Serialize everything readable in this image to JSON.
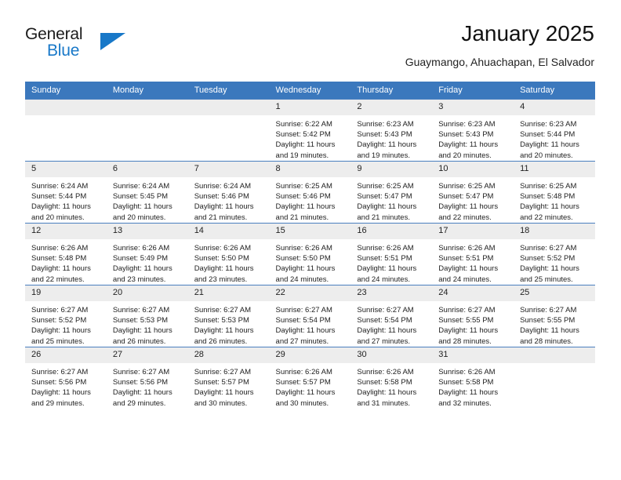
{
  "brand": {
    "word_top": "General",
    "word_bottom": "Blue",
    "triangle_icon": "triangle-icon",
    "accent_color": "#1878c8"
  },
  "header": {
    "title": "January 2025",
    "subtitle": "Guaymango, Ahuachapan, El Salvador"
  },
  "calendar": {
    "header_color": "#3b78bd",
    "daynum_band_color": "#ededed",
    "weekday_headers": [
      "Sunday",
      "Monday",
      "Tuesday",
      "Wednesday",
      "Thursday",
      "Friday",
      "Saturday"
    ],
    "weeks": [
      [
        {
          "day": "",
          "sunrise": "",
          "sunset": "",
          "daylight_line1": "",
          "daylight_line2": ""
        },
        {
          "day": "",
          "sunrise": "",
          "sunset": "",
          "daylight_line1": "",
          "daylight_line2": ""
        },
        {
          "day": "",
          "sunrise": "",
          "sunset": "",
          "daylight_line1": "",
          "daylight_line2": ""
        },
        {
          "day": "1",
          "sunrise": "Sunrise: 6:22 AM",
          "sunset": "Sunset: 5:42 PM",
          "daylight_line1": "Daylight: 11 hours",
          "daylight_line2": "and 19 minutes."
        },
        {
          "day": "2",
          "sunrise": "Sunrise: 6:23 AM",
          "sunset": "Sunset: 5:43 PM",
          "daylight_line1": "Daylight: 11 hours",
          "daylight_line2": "and 19 minutes."
        },
        {
          "day": "3",
          "sunrise": "Sunrise: 6:23 AM",
          "sunset": "Sunset: 5:43 PM",
          "daylight_line1": "Daylight: 11 hours",
          "daylight_line2": "and 20 minutes."
        },
        {
          "day": "4",
          "sunrise": "Sunrise: 6:23 AM",
          "sunset": "Sunset: 5:44 PM",
          "daylight_line1": "Daylight: 11 hours",
          "daylight_line2": "and 20 minutes."
        }
      ],
      [
        {
          "day": "5",
          "sunrise": "Sunrise: 6:24 AM",
          "sunset": "Sunset: 5:44 PM",
          "daylight_line1": "Daylight: 11 hours",
          "daylight_line2": "and 20 minutes."
        },
        {
          "day": "6",
          "sunrise": "Sunrise: 6:24 AM",
          "sunset": "Sunset: 5:45 PM",
          "daylight_line1": "Daylight: 11 hours",
          "daylight_line2": "and 20 minutes."
        },
        {
          "day": "7",
          "sunrise": "Sunrise: 6:24 AM",
          "sunset": "Sunset: 5:46 PM",
          "daylight_line1": "Daylight: 11 hours",
          "daylight_line2": "and 21 minutes."
        },
        {
          "day": "8",
          "sunrise": "Sunrise: 6:25 AM",
          "sunset": "Sunset: 5:46 PM",
          "daylight_line1": "Daylight: 11 hours",
          "daylight_line2": "and 21 minutes."
        },
        {
          "day": "9",
          "sunrise": "Sunrise: 6:25 AM",
          "sunset": "Sunset: 5:47 PM",
          "daylight_line1": "Daylight: 11 hours",
          "daylight_line2": "and 21 minutes."
        },
        {
          "day": "10",
          "sunrise": "Sunrise: 6:25 AM",
          "sunset": "Sunset: 5:47 PM",
          "daylight_line1": "Daylight: 11 hours",
          "daylight_line2": "and 22 minutes."
        },
        {
          "day": "11",
          "sunrise": "Sunrise: 6:25 AM",
          "sunset": "Sunset: 5:48 PM",
          "daylight_line1": "Daylight: 11 hours",
          "daylight_line2": "and 22 minutes."
        }
      ],
      [
        {
          "day": "12",
          "sunrise": "Sunrise: 6:26 AM",
          "sunset": "Sunset: 5:48 PM",
          "daylight_line1": "Daylight: 11 hours",
          "daylight_line2": "and 22 minutes."
        },
        {
          "day": "13",
          "sunrise": "Sunrise: 6:26 AM",
          "sunset": "Sunset: 5:49 PM",
          "daylight_line1": "Daylight: 11 hours",
          "daylight_line2": "and 23 minutes."
        },
        {
          "day": "14",
          "sunrise": "Sunrise: 6:26 AM",
          "sunset": "Sunset: 5:50 PM",
          "daylight_line1": "Daylight: 11 hours",
          "daylight_line2": "and 23 minutes."
        },
        {
          "day": "15",
          "sunrise": "Sunrise: 6:26 AM",
          "sunset": "Sunset: 5:50 PM",
          "daylight_line1": "Daylight: 11 hours",
          "daylight_line2": "and 24 minutes."
        },
        {
          "day": "16",
          "sunrise": "Sunrise: 6:26 AM",
          "sunset": "Sunset: 5:51 PM",
          "daylight_line1": "Daylight: 11 hours",
          "daylight_line2": "and 24 minutes."
        },
        {
          "day": "17",
          "sunrise": "Sunrise: 6:26 AM",
          "sunset": "Sunset: 5:51 PM",
          "daylight_line1": "Daylight: 11 hours",
          "daylight_line2": "and 24 minutes."
        },
        {
          "day": "18",
          "sunrise": "Sunrise: 6:27 AM",
          "sunset": "Sunset: 5:52 PM",
          "daylight_line1": "Daylight: 11 hours",
          "daylight_line2": "and 25 minutes."
        }
      ],
      [
        {
          "day": "19",
          "sunrise": "Sunrise: 6:27 AM",
          "sunset": "Sunset: 5:52 PM",
          "daylight_line1": "Daylight: 11 hours",
          "daylight_line2": "and 25 minutes."
        },
        {
          "day": "20",
          "sunrise": "Sunrise: 6:27 AM",
          "sunset": "Sunset: 5:53 PM",
          "daylight_line1": "Daylight: 11 hours",
          "daylight_line2": "and 26 minutes."
        },
        {
          "day": "21",
          "sunrise": "Sunrise: 6:27 AM",
          "sunset": "Sunset: 5:53 PM",
          "daylight_line1": "Daylight: 11 hours",
          "daylight_line2": "and 26 minutes."
        },
        {
          "day": "22",
          "sunrise": "Sunrise: 6:27 AM",
          "sunset": "Sunset: 5:54 PM",
          "daylight_line1": "Daylight: 11 hours",
          "daylight_line2": "and 27 minutes."
        },
        {
          "day": "23",
          "sunrise": "Sunrise: 6:27 AM",
          "sunset": "Sunset: 5:54 PM",
          "daylight_line1": "Daylight: 11 hours",
          "daylight_line2": "and 27 minutes."
        },
        {
          "day": "24",
          "sunrise": "Sunrise: 6:27 AM",
          "sunset": "Sunset: 5:55 PM",
          "daylight_line1": "Daylight: 11 hours",
          "daylight_line2": "and 28 minutes."
        },
        {
          "day": "25",
          "sunrise": "Sunrise: 6:27 AM",
          "sunset": "Sunset: 5:55 PM",
          "daylight_line1": "Daylight: 11 hours",
          "daylight_line2": "and 28 minutes."
        }
      ],
      [
        {
          "day": "26",
          "sunrise": "Sunrise: 6:27 AM",
          "sunset": "Sunset: 5:56 PM",
          "daylight_line1": "Daylight: 11 hours",
          "daylight_line2": "and 29 minutes."
        },
        {
          "day": "27",
          "sunrise": "Sunrise: 6:27 AM",
          "sunset": "Sunset: 5:56 PM",
          "daylight_line1": "Daylight: 11 hours",
          "daylight_line2": "and 29 minutes."
        },
        {
          "day": "28",
          "sunrise": "Sunrise: 6:27 AM",
          "sunset": "Sunset: 5:57 PM",
          "daylight_line1": "Daylight: 11 hours",
          "daylight_line2": "and 30 minutes."
        },
        {
          "day": "29",
          "sunrise": "Sunrise: 6:26 AM",
          "sunset": "Sunset: 5:57 PM",
          "daylight_line1": "Daylight: 11 hours",
          "daylight_line2": "and 30 minutes."
        },
        {
          "day": "30",
          "sunrise": "Sunrise: 6:26 AM",
          "sunset": "Sunset: 5:58 PM",
          "daylight_line1": "Daylight: 11 hours",
          "daylight_line2": "and 31 minutes."
        },
        {
          "day": "31",
          "sunrise": "Sunrise: 6:26 AM",
          "sunset": "Sunset: 5:58 PM",
          "daylight_line1": "Daylight: 11 hours",
          "daylight_line2": "and 32 minutes."
        },
        {
          "day": "",
          "sunrise": "",
          "sunset": "",
          "daylight_line1": "",
          "daylight_line2": ""
        }
      ]
    ]
  }
}
